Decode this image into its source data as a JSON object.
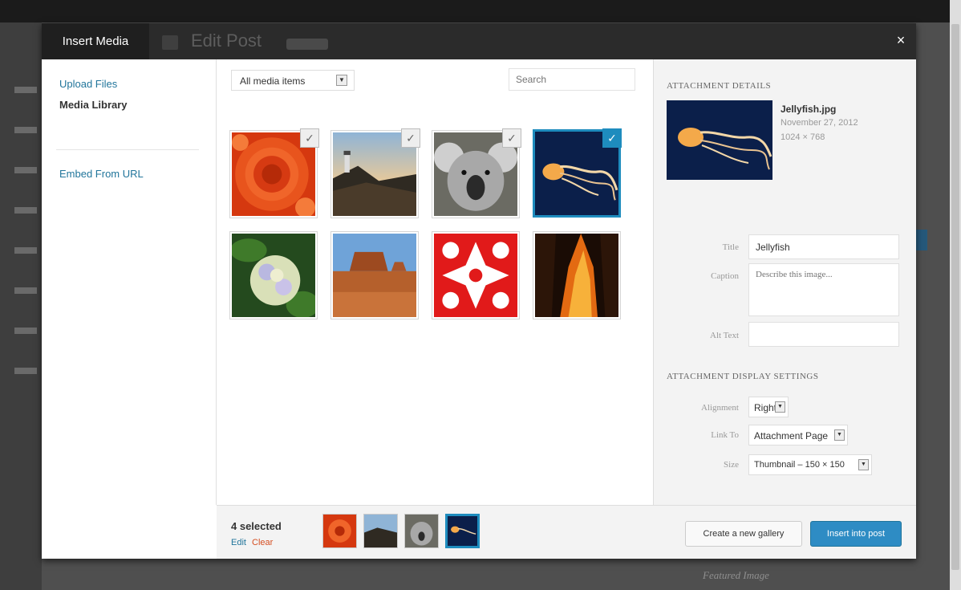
{
  "modal": {
    "title": "Insert Media",
    "close_icon": "×",
    "ghost_title": "Edit Post"
  },
  "menu": {
    "upload_files": "Upload Files",
    "media_library": "Media Library",
    "embed_from_url": "Embed From URL"
  },
  "browser": {
    "filter_label": "All media items",
    "search_placeholder": "Search",
    "attachments": [
      {
        "name": "flower",
        "selected": true
      },
      {
        "name": "lighthouse",
        "selected": true
      },
      {
        "name": "koala",
        "selected": true
      },
      {
        "name": "jellyfish",
        "selected": true,
        "focused": true
      },
      {
        "name": "hydrangea",
        "selected": false
      },
      {
        "name": "desert",
        "selected": false
      },
      {
        "name": "tulips",
        "selected": false
      },
      {
        "name": "fire",
        "selected": false
      }
    ],
    "check_glyph": "✓"
  },
  "details": {
    "heading": "Attachment Details",
    "file_name": "Jellyfish.jpg",
    "file_date": "November 27, 2012",
    "file_dims": "1024 × 768",
    "title_label": "Title",
    "title_value": "Jellyfish",
    "caption_label": "Caption",
    "caption_placeholder": "Describe this image...",
    "alt_label": "Alt Text",
    "alt_value": ""
  },
  "display_settings": {
    "heading": "Attachment Display Settings",
    "alignment_label": "Alignment",
    "alignment_value": "Right",
    "link_label": "Link To",
    "link_value": "Attachment Page",
    "size_label": "Size",
    "size_value": "Thumbnail – 150 × 150"
  },
  "toolbar": {
    "selected_count": "4 selected",
    "edit_label": "Edit",
    "clear_label": "Clear",
    "gallery_button": "Create a new gallery",
    "insert_button": "Insert into post"
  },
  "background": {
    "featured_image": "Featured Image"
  },
  "colors": {
    "accent": "#1e8cbe",
    "link": "#21759b",
    "clear": "#d54e21",
    "header": "#2b2b2b"
  }
}
